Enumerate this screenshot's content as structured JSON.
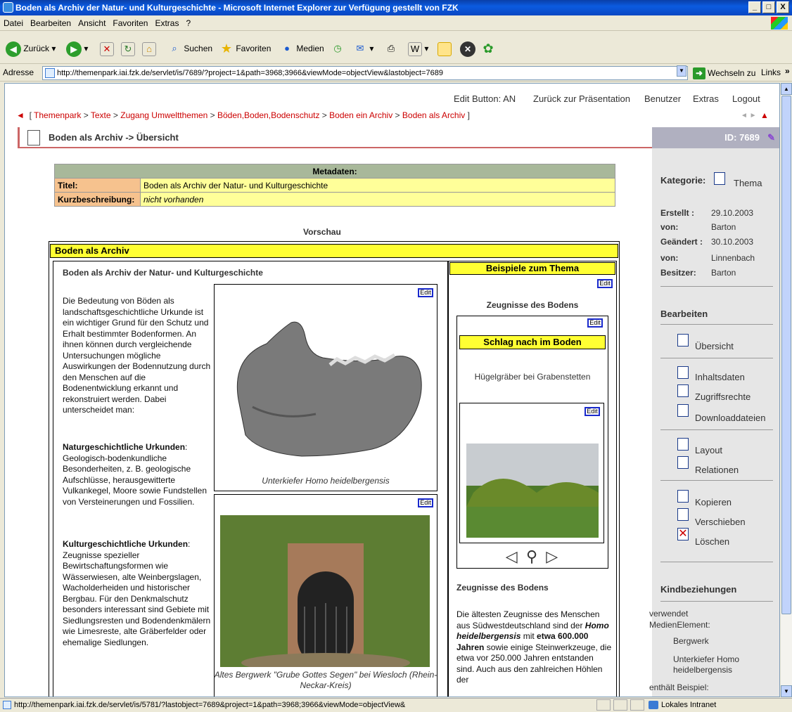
{
  "window": {
    "title": "Boden als Archiv der Natur- und Kulturgeschichte - Microsoft Internet Explorer  zur Verfügung gestellt von FZK",
    "min": "_",
    "max": "□",
    "close": "X"
  },
  "menu": [
    "Datei",
    "Bearbeiten",
    "Ansicht",
    "Favoriten",
    "Extras",
    "?"
  ],
  "toolbar": {
    "back": "Zurück",
    "search": "Suchen",
    "favorites": "Favoriten",
    "media": "Medien"
  },
  "address": {
    "label": "Adresse",
    "url": "http://themenpark.iai.fzk.de/servlet/is/7689/?project=1&path=3968;3966&viewMode=objectView&lastobject=7689",
    "go": "Wechseln zu",
    "links": "Links"
  },
  "topnav": {
    "edit": "Edit Button: AN",
    "back": "Zurück zur Präsentation",
    "user": "Benutzer",
    "extras": "Extras",
    "logout": "Logout"
  },
  "breadcrumb": {
    "open": "[",
    "items": [
      "Themenpark",
      "Texte",
      "Zugang Umweltthemen",
      "Böden,Boden,Bodenschutz",
      "Boden ein Archiv",
      "Boden als Archiv"
    ],
    "close": "]"
  },
  "header": {
    "title": "Boden als Archiv -> Übersicht",
    "id": "ID: 7689"
  },
  "meta": {
    "header": "Metadaten:",
    "title_label": "Titel:",
    "title_value": "Boden als Archiv der Natur- und Kulturgeschichte",
    "desc_label": "Kurzbeschreibung:",
    "desc_value": "nicht vorhanden"
  },
  "preview": {
    "label": "Vorschau",
    "box_title": "Boden als Archiv",
    "main_heading": "Boden als Archiv der Natur- und Kulturgeschichte",
    "intro": "Die Bedeutung von Böden als landschaftsgeschichtliche Urkunde ist ein wichtiger Grund für den Schutz und Erhalt bestimmter Bodenformen. An ihnen können durch vergleichende Untersuchungen mögliche Auswirkungen der Bodennutzung durch den Menschen auf die Bodenentwicklung erkannt und rekonstruiert werden. Dabei unterscheidet man:",
    "nature_heading": "Naturgeschichtliche Urkunden",
    "nature_text": "Geologisch-bodenkundliche Besonderheiten, z. B. geologische Aufschlüsse, herausgewitterte Vulkankegel, Moore sowie Fundstellen von Versteinerungen und Fossilien.",
    "culture_heading": "Kulturgeschichtliche Urkunden",
    "culture_text": "Zeugnisse spezieller Bewirtschaftungsformen wie Wässerwiesen, alte Weinbergslagen, Wacholderheiden und historischer Bergbau. Für den Denkmalschutz besonders interessant sind Gebiete mit Siedlungsresten und Bodendenkmälern wie Limesreste, alte Gräberfelder oder ehemalige Siedlungen.",
    "img1_caption": "Unterkiefer Homo heidelbergensis",
    "img2_caption": "Altes Bergwerk \"Grube Gottes Segen\" bei Wiesloch (Rhein-Neckar-Kreis)",
    "edit": "Edit",
    "examples_title": "Beispiele zum Thema",
    "zeugnisse": "Zeugnisse des Bodens",
    "schlag": "Schlag nach im Boden",
    "huegel": "Hügelgräber bei Grabenstetten",
    "zeug2_heading": "Zeugnisse des Bodens",
    "zeug2_text_a": "Die ältesten Zeugnisse des Menschen aus Südwestdeutschland sind der ",
    "zeug2_bold1": "Homo heidelbergensis",
    "zeug2_text_b": " mit ",
    "zeug2_bold2": "etwa 600.000 Jahren",
    "zeug2_text_c": " sowie einige Steinwerkzeuge, die etwa vor 250.000 Jahren entstanden sind. Auch aus den zahlreichen Höhlen der"
  },
  "sidebar": {
    "kategorie_label": "Kategorie:",
    "kategorie_value": "Thema",
    "erstellt_label": "Erstellt :",
    "erstellt_value": "29.10.2003",
    "von1_label": "von:",
    "von1_value": "Barton",
    "geaendert_label": "Geändert :",
    "geaendert_value": "30.10.2003",
    "von2_label": "von:",
    "von2_value": "Linnenbach",
    "besitzer_label": "Besitzer:",
    "besitzer_value": "Barton",
    "bearbeiten": "Bearbeiten",
    "actions": [
      "Übersicht",
      "Inhaltsdaten",
      "Zugriffsrechte",
      "Downloaddateien",
      "Layout",
      "Relationen",
      "Kopieren",
      "Verschieben",
      "Löschen"
    ],
    "kind": "Kindbeziehungen",
    "verwendet": "verwendet MedienElement:",
    "links": [
      "Bergwerk",
      "Unterkiefer Homo heidelbergensis"
    ],
    "enthaelt": "enthält Beispiel:"
  },
  "status": {
    "url": "http://themenpark.iai.fzk.de/servlet/is/5781/?lastobject=7689&project=1&path=3968;3966&viewMode=objectView&",
    "zone": "Lokales Intranet"
  }
}
